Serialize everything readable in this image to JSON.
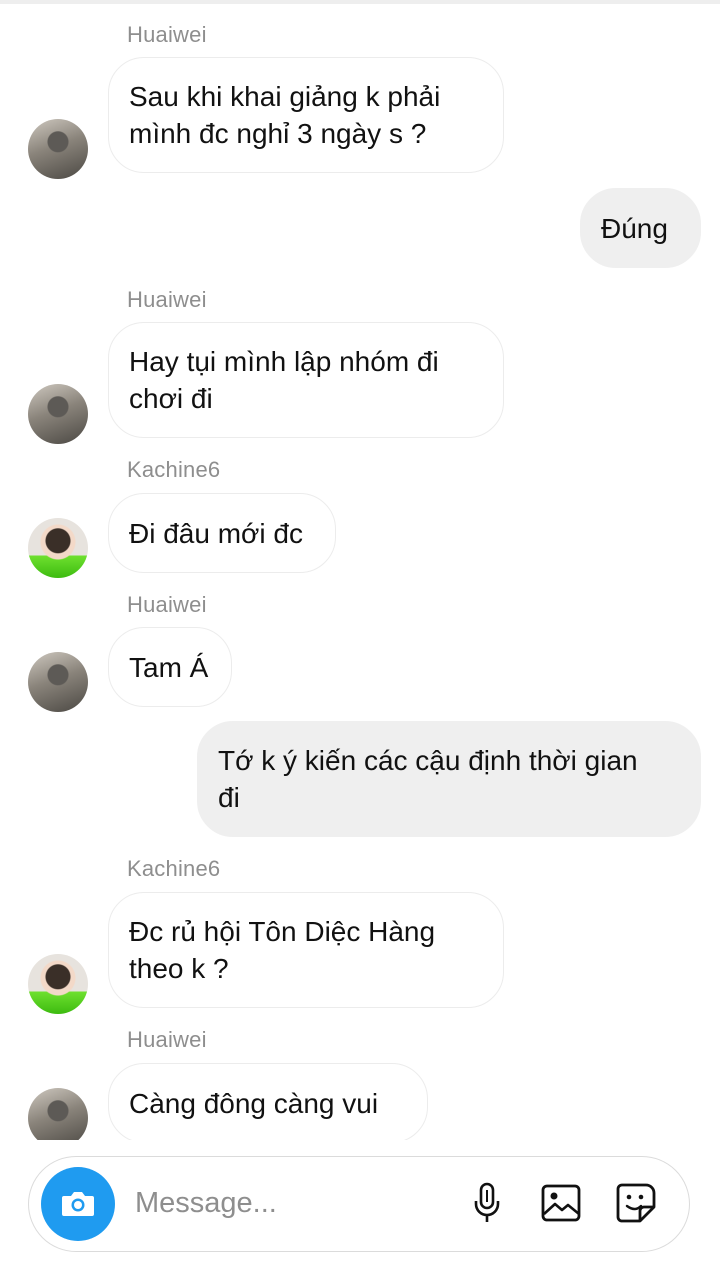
{
  "messages": [
    {
      "type": "in",
      "sender": "Huaiwei",
      "avatar": "huaiwei-avatar",
      "text": "Sau khi khai giảng k phải\nmình đc nghỉ 3 ngày s ?"
    },
    {
      "type": "out",
      "text": "Đúng"
    },
    {
      "type": "in",
      "sender": "Huaiwei",
      "avatar": "huaiwei-avatar",
      "text": "Hay tụi mình lập nhóm đi\nchơi đi"
    },
    {
      "type": "in",
      "sender": "Kachine6",
      "avatar": "kachine6-avatar",
      "text": "Đi đâu mới đc"
    },
    {
      "type": "in",
      "sender": "Huaiwei",
      "avatar": "huaiwei-avatar",
      "text": "Tam Á"
    },
    {
      "type": "out",
      "text": "Tớ k ý kiến các cậu định thời gian\nđi"
    },
    {
      "type": "in",
      "sender": "Kachine6",
      "avatar": "kachine6-avatar",
      "text": "Đc rủ hội Tôn Diệc Hàng\ntheo k ?"
    },
    {
      "type": "in",
      "sender": "Huaiwei",
      "avatar": "huaiwei-avatar",
      "text": "Càng đông càng vui"
    }
  ],
  "composer": {
    "placeholder": "Message...",
    "icons": [
      "camera-icon",
      "microphone-icon",
      "gallery-icon",
      "sticker-icon"
    ]
  },
  "colors": {
    "camera_button": "#1f9bf0",
    "outgoing_bubble": "#efefef",
    "sender_name": "#8e8e8e"
  }
}
